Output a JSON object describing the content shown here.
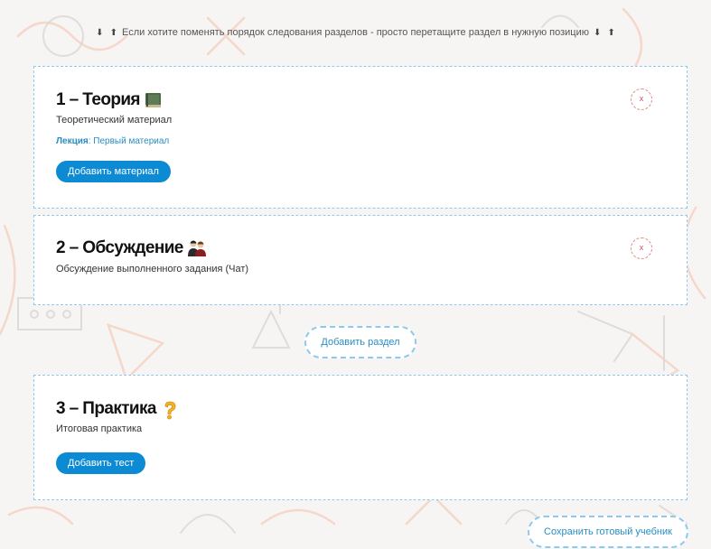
{
  "hint": {
    "text": "Если хотите поменять порядок следования разделов - просто перетащите раздел в нужную позицию",
    "arrow_down": "⬇",
    "arrow_up": "⬆"
  },
  "sections": [
    {
      "title": "1 – Теория",
      "icon": "book-icon",
      "description": "Теоретический материал",
      "material_type": "Лекция",
      "material_name": ": Первый материал",
      "button_label": "Добавить материал",
      "close_label": "x"
    },
    {
      "title": "2 – Обсуждение",
      "icon": "people-icon",
      "description": "Обсуждение выполненного задания (Чат)",
      "close_label": "x"
    },
    {
      "title": "3 – Практика",
      "icon": "question-icon",
      "description": "Итоговая практика",
      "button_label": "Добавить тест"
    }
  ],
  "add_section_label": "Добавить раздел",
  "save_label": "Сохранить готовый учебник",
  "colors": {
    "accent": "#0c8ad3",
    "border": "#8cc9ec",
    "close": "#e08b86",
    "link": "#2a8dc2"
  }
}
